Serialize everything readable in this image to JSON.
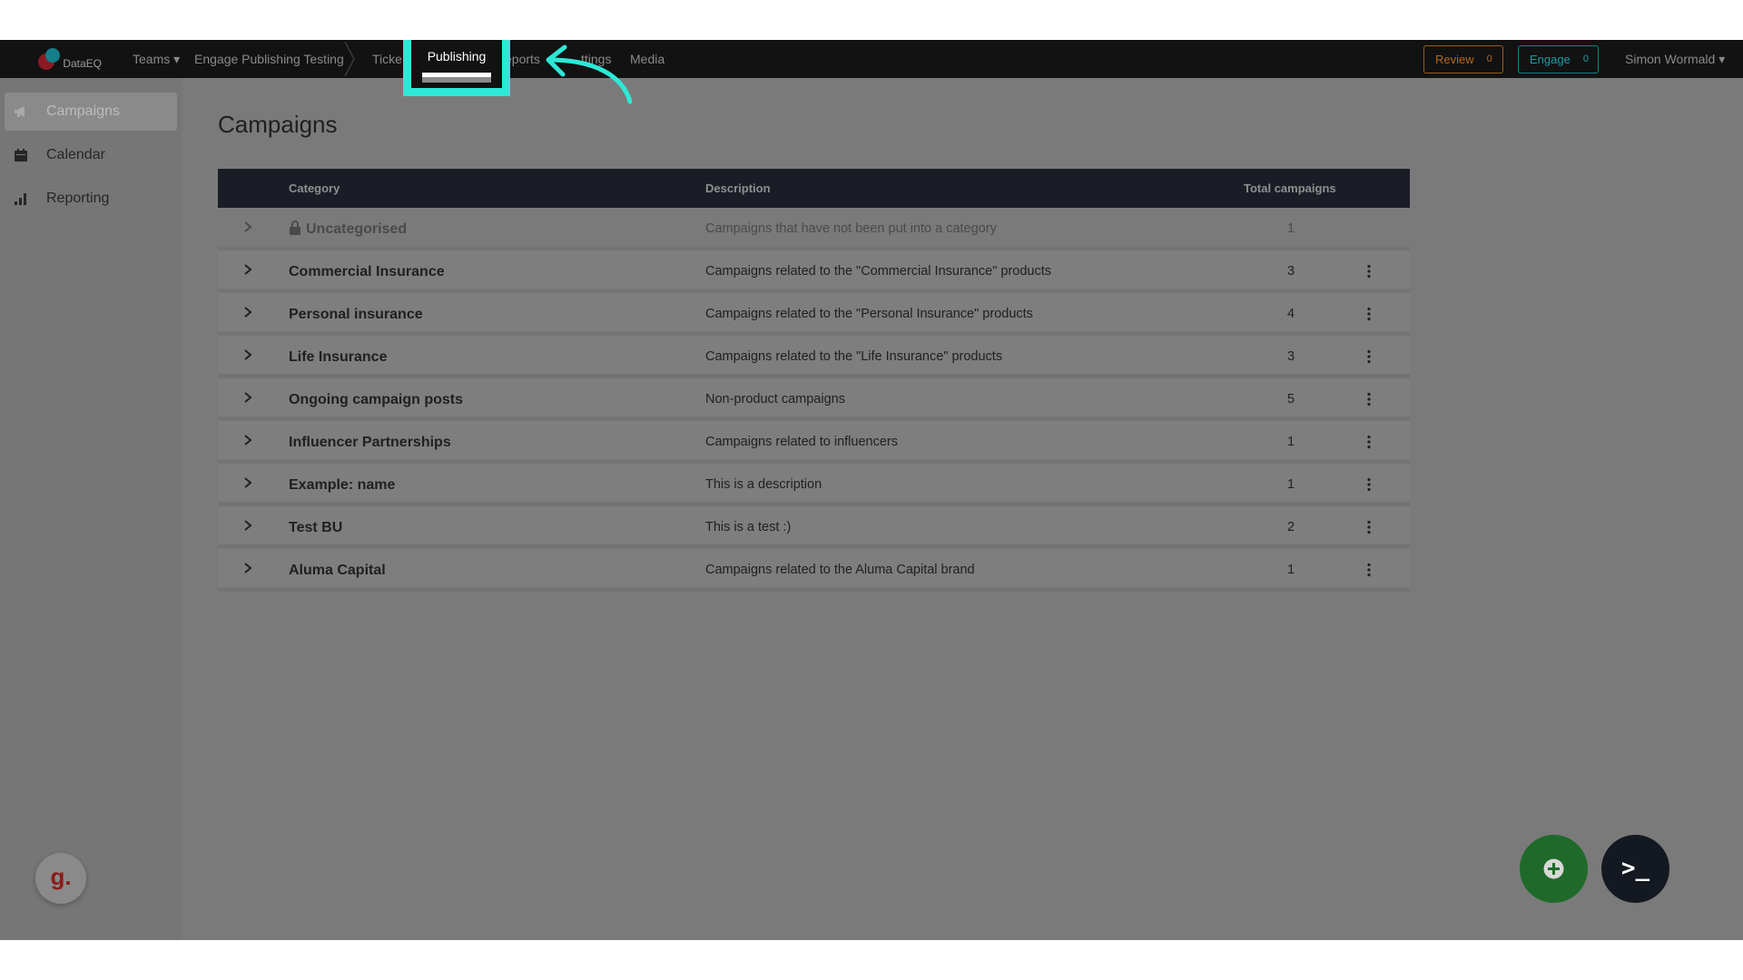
{
  "app": {
    "logo_text": "DataEQ"
  },
  "topnav": {
    "teams": "Teams ▾",
    "breadcrumb": "Engage Publishing Testing",
    "items": [
      {
        "label": "Ticke"
      },
      {
        "label": "Publishing",
        "active": true
      },
      {
        "label": "eports"
      },
      {
        "label": "ttings"
      },
      {
        "label": "Media"
      }
    ],
    "review": {
      "label": "Review",
      "count": "0"
    },
    "engage": {
      "label": "Engage",
      "count": "0"
    },
    "user": "Simon Wormald ▾"
  },
  "sidebar": {
    "items": [
      {
        "label": "Campaigns",
        "icon": "megaphone-icon",
        "active": true
      },
      {
        "label": "Calendar",
        "icon": "calendar-icon"
      },
      {
        "label": "Reporting",
        "icon": "bar-chart-icon"
      }
    ]
  },
  "main": {
    "title": "Campaigns",
    "columns": {
      "category": "Category",
      "description": "Description",
      "total": "Total campaigns"
    },
    "rows": [
      {
        "category": "Uncategorised",
        "description": "Campaigns that have not been put into a category",
        "total": "1",
        "locked": true
      },
      {
        "category": "Commercial Insurance",
        "description": "Campaigns related to the \"Commercial Insurance\" products",
        "total": "3"
      },
      {
        "category": "Personal insurance",
        "description": "Campaigns related to the \"Personal Insurance\" products",
        "total": "4"
      },
      {
        "category": "Life Insurance",
        "description": "Campaigns related to the \"Life Insurance\" products",
        "total": "3"
      },
      {
        "category": "Ongoing campaign posts",
        "description": "Non-product campaigns",
        "total": "5"
      },
      {
        "category": "Influencer Partnerships",
        "description": "Campaigns related to influencers",
        "total": "1"
      },
      {
        "category": "Example: name",
        "description": "This is a description",
        "total": "1"
      },
      {
        "category": "Test BU",
        "description": "This is a test :)",
        "total": "2"
      },
      {
        "category": "Aluma Capital",
        "description": "Campaigns related to the Aluma Capital brand",
        "total": "1"
      }
    ]
  },
  "widgets": {
    "g_label": "g.",
    "terminal_label": ">_"
  },
  "colors": {
    "highlight": "#2ee8d6",
    "nav_bg": "#121212",
    "table_header": "#1b1d26",
    "add_fab": "#1f6a2a"
  }
}
